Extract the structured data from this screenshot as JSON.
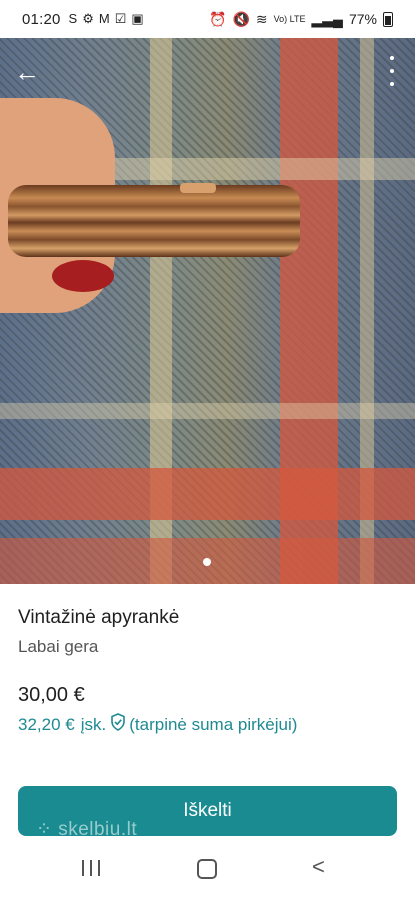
{
  "status_bar": {
    "time": "01:20",
    "left_icons": [
      "skype-icon",
      "gear-icon",
      "gmail-icon",
      "check-icon",
      "gallery-icon"
    ],
    "network_label": "Vo) LTE",
    "battery": "77%"
  },
  "product": {
    "title": "Vintažinė apyrankė",
    "condition": "Labai gera",
    "price": "30,00 €",
    "price_total": "32,20 €",
    "price_total_suffix": "įsk.",
    "price_total_note": "(tarpinė suma pirkėjui)"
  },
  "gallery": {
    "page_count": 1,
    "current_page": 1
  },
  "cta": {
    "label": "Iškelti"
  },
  "watermark": "skelbiu.lt",
  "colors": {
    "accent": "#1a8c91",
    "price_total_text": "#1f8a92"
  }
}
